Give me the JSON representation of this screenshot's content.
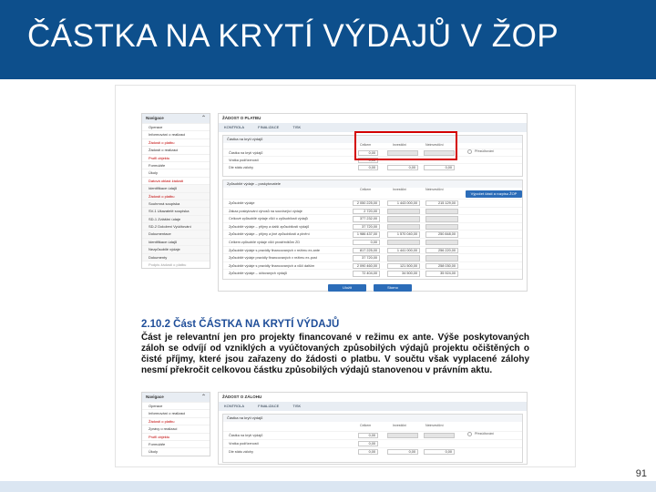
{
  "slide": {
    "title": "ČÁSTKA NA KRYTÍ VÝDAJŮ V ŽOP",
    "page_number": "91"
  },
  "screenshot1": {
    "nav": {
      "header": "Navigace",
      "items": [
        {
          "label": "Operace",
          "state": "normal"
        },
        {
          "label": "Informování o realizaci",
          "state": "normal"
        },
        {
          "label": "Žádosti o platbu",
          "state": "active"
        },
        {
          "label": "Žádosti o realizaci",
          "state": "normal"
        },
        {
          "label": "Profil objektu",
          "state": "active"
        },
        {
          "label": "Formuláře",
          "state": "normal"
        },
        {
          "label": "Úkoly",
          "state": "normal"
        },
        {
          "label": "Datová oblast žádosti",
          "state": "active"
        },
        {
          "label": "Identifikace údajů",
          "state": "sub"
        },
        {
          "label": "Žádosti o platbu",
          "state": "active-sub"
        },
        {
          "label": "Souhrnná soupiska",
          "state": "sub"
        },
        {
          "label": "SV-1 Ukazatelé soupiska",
          "state": "sub"
        },
        {
          "label": "SD-1 Zvláštní údaje",
          "state": "sub"
        },
        {
          "label": "SD-2 Doložení Vyúčtování",
          "state": "sub"
        },
        {
          "label": "Dokumentace",
          "state": "sub"
        },
        {
          "label": "Identifikace údajů",
          "state": "sub"
        },
        {
          "label": "Nezpůsobilé výdaje",
          "state": "sub"
        },
        {
          "label": "Dokumenty",
          "state": "sub"
        },
        {
          "label": "Podpis žádosti o platbu",
          "state": "grey"
        }
      ]
    },
    "panel": {
      "title": "ŽÁDOST O PLATBU",
      "toolbar": [
        "KONTROLA",
        "FINALIZACE",
        "TISK"
      ],
      "section1_title": "Částka na krytí výdajů",
      "col_headers": [
        "Celkem",
        "Investiční",
        "Neinvestiční"
      ],
      "section1_rows": [
        {
          "label": "Částka na krytí výdajů",
          "total": "0,00"
        },
        {
          "label": "Vratka podřízenosti",
          "total": "0,00"
        },
        {
          "label": "Dle státu zálohy",
          "total": "0,00",
          "inv": "0,00",
          "neinv": "0,00"
        }
      ],
      "radio_label": "Přezúčtování",
      "section2_title": "Způsobilé výdaje – poskytovatele",
      "calc_button": "Výpočet částí a rozpisu ŽOP",
      "section2_rows": [
        {
          "label": "Způsobilé výdaje",
          "total": "2 050 225,00",
          "inv": "1 443 000,00",
          "neinv": "215 129,00"
        },
        {
          "label": "Zákaz poskytování výnosů na související výdaje",
          "total": "2 720,00"
        },
        {
          "label": "Celkové způsobilé výdaje vůči o způsobilosti výdajů",
          "total": "377 232,00"
        },
        {
          "label": "Způsobilé výdaje – příjmy a další způsobilosti výdajů",
          "total": "37 720,00"
        },
        {
          "label": "Způsobilé výdaje – příjmy a jiné způsobilosti a plnění",
          "total": "1 986 437,00",
          "inv": "1 570 040,00",
          "neinv": "250 848,00"
        },
        {
          "label": "Celkem způsobilé výdaje vůči prostředkům ZD",
          "total": "0,00"
        },
        {
          "label": "Způsobilé výdaje s pravidly financovaných v režimu ex-ante",
          "total": "817 225,00",
          "inv": "1 441 000,00",
          "neinv": "256 220,00"
        },
        {
          "label": "Způsobilé výdaje pravidly financovaných v režimu ex-post",
          "total": "37 720,00"
        },
        {
          "label": "Způsobilé výdaje s pravidly financovaných a vůči dalším",
          "total": "2 090 460,00",
          "inv": "121 500,00",
          "neinv": "258 030,00"
        },
        {
          "label": "Způsobilé výdaje – účtovaných výdajů",
          "total": "72 404,00",
          "inv": "34 500,00",
          "neinv": "35 924,00"
        }
      ],
      "buttons": [
        "Uložit",
        "Storno"
      ]
    }
  },
  "section_heading": "2.10.2 Část ČÁSTKA NA KRYTÍ VÝDAJŮ",
  "paragraph": "Část je relevantní jen pro projekty financované v režimu ex ante. Výše poskytovaných záloh se odvíjí od vzniklých a vyúčtovaných způsobilých výdajů projektu očištěných o čisté příjmy, které jsou zařazeny do žádosti o platbu. V součtu však vyplacené zálohy nesmí překročit celkovou částku způsobilých výdajů stanovenou v právním aktu.",
  "screenshot2": {
    "nav": {
      "header": "Navigace",
      "items": [
        {
          "label": "Operace",
          "state": "normal"
        },
        {
          "label": "Informování o realizaci",
          "state": "normal"
        },
        {
          "label": "Žádosti o platbu",
          "state": "active"
        },
        {
          "label": "Zprávy o realizaci",
          "state": "normal"
        },
        {
          "label": "Profil objektu",
          "state": "active"
        },
        {
          "label": "Formuláře",
          "state": "normal"
        },
        {
          "label": "Úkoly",
          "state": "normal"
        }
      ]
    },
    "panel": {
      "title": "ŽÁDOST O ZÁLOHU",
      "toolbar": [
        "KONTROLA",
        "FINALIZACE",
        "TISK"
      ],
      "section_title": "Částka na krytí výdajů",
      "col_headers": [
        "Celkem",
        "Investiční",
        "Neinvestiční"
      ],
      "rows": [
        {
          "label": "Částka na krytí výdajů",
          "total": "0,00"
        },
        {
          "label": "Vratka podřízenosti",
          "total": "0,00"
        },
        {
          "label": "Dle státu zálohy",
          "total": "0,00",
          "inv": "0,00",
          "neinv": "0,00"
        }
      ],
      "radio_label": "Přezúčtování"
    }
  },
  "colors": {
    "header_bg": "#0d4f8c",
    "highlight": "#d40000",
    "button": "#2b6cb8",
    "heading": "#1f4e99"
  }
}
